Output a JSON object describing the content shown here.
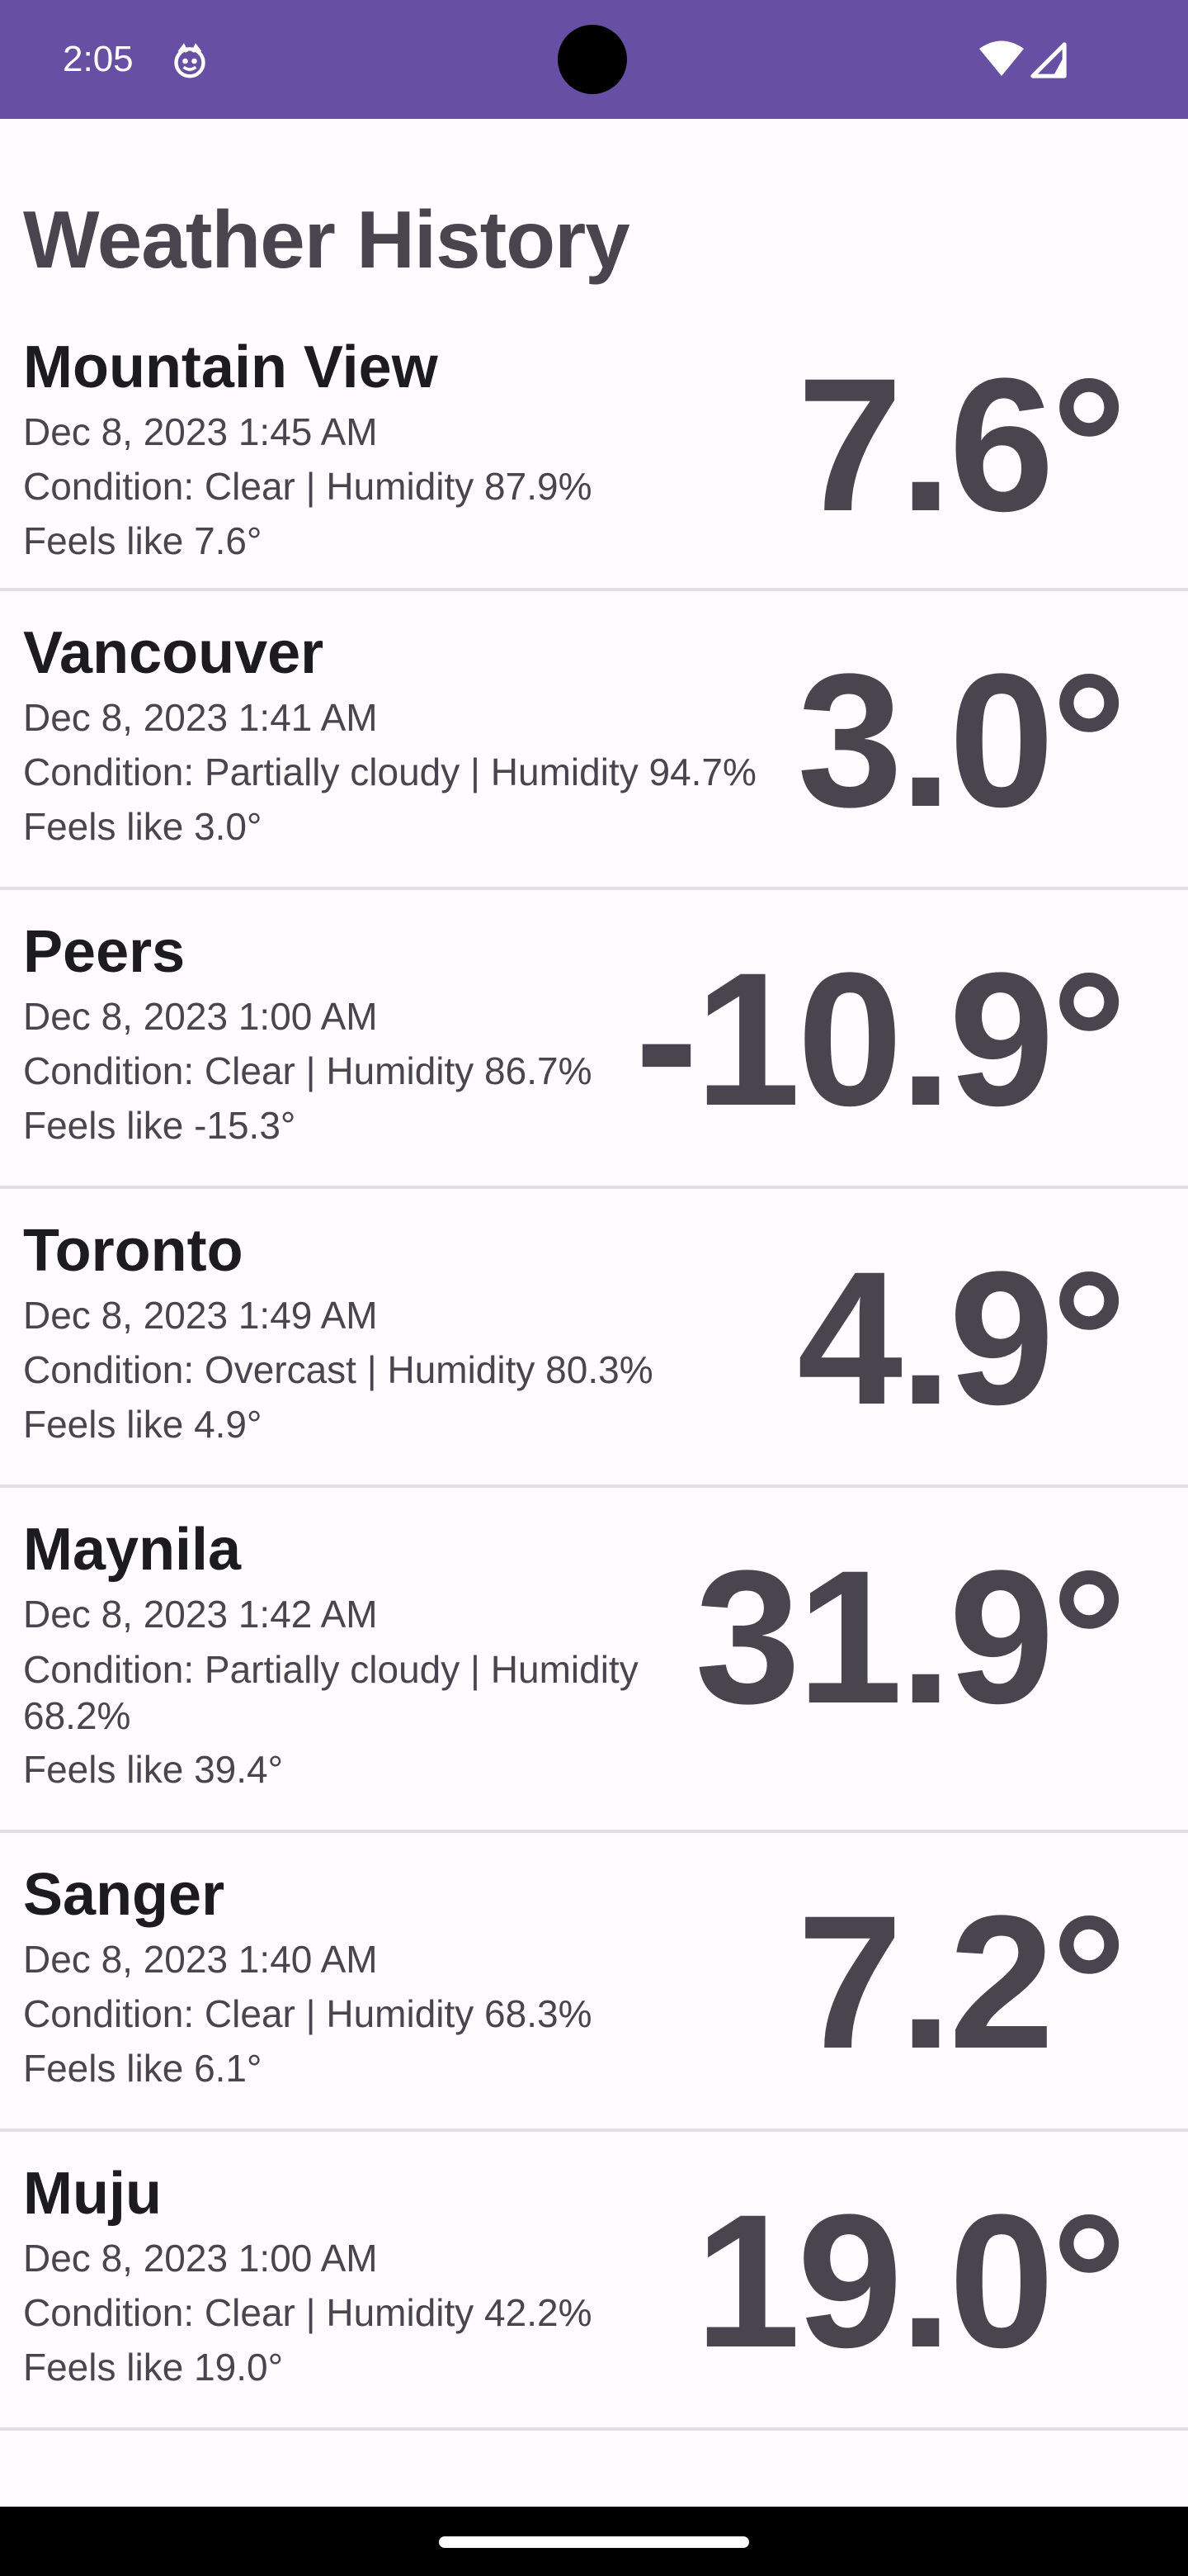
{
  "status_bar": {
    "time": "2:05",
    "background_color": "#6750a4"
  },
  "title": "Weather History",
  "history": [
    {
      "city": "Mountain View",
      "datetime": "Dec 8, 2023 1:45 AM",
      "condition": "Condition: Clear | Humidity 87.9%",
      "feels_like": "Feels like 7.6°",
      "temperature": "7.6°"
    },
    {
      "city": "Vancouver",
      "datetime": "Dec 8, 2023 1:41 AM",
      "condition": "Condition: Partially cloudy | Humidity 94.7%",
      "feels_like": "Feels like 3.0°",
      "temperature": "3.0°"
    },
    {
      "city": "Peers",
      "datetime": "Dec 8, 2023 1:00 AM",
      "condition": "Condition: Clear | Humidity 86.7%",
      "feels_like": "Feels like -15.3°",
      "temperature": "-10.9°"
    },
    {
      "city": "Toronto",
      "datetime": "Dec 8, 2023 1:49 AM",
      "condition": "Condition: Overcast | Humidity 80.3%",
      "feels_like": "Feels like 4.9°",
      "temperature": "4.9°"
    },
    {
      "city": "Maynila",
      "datetime": "Dec 8, 2023 1:42 AM",
      "condition": "Condition: Partially cloudy | Humidity 68.2%",
      "feels_like": "Feels like 39.4°",
      "temperature": "31.9°"
    },
    {
      "city": "Sanger",
      "datetime": "Dec 8, 2023 1:40 AM",
      "condition": "Condition: Clear | Humidity 68.3%",
      "feels_like": "Feels like 6.1°",
      "temperature": "7.2°"
    },
    {
      "city": "Muju",
      "datetime": "Dec 8, 2023 1:00 AM",
      "condition": "Condition: Clear | Humidity 42.2%",
      "feels_like": "Feels like 19.0°",
      "temperature": "19.0°"
    }
  ]
}
